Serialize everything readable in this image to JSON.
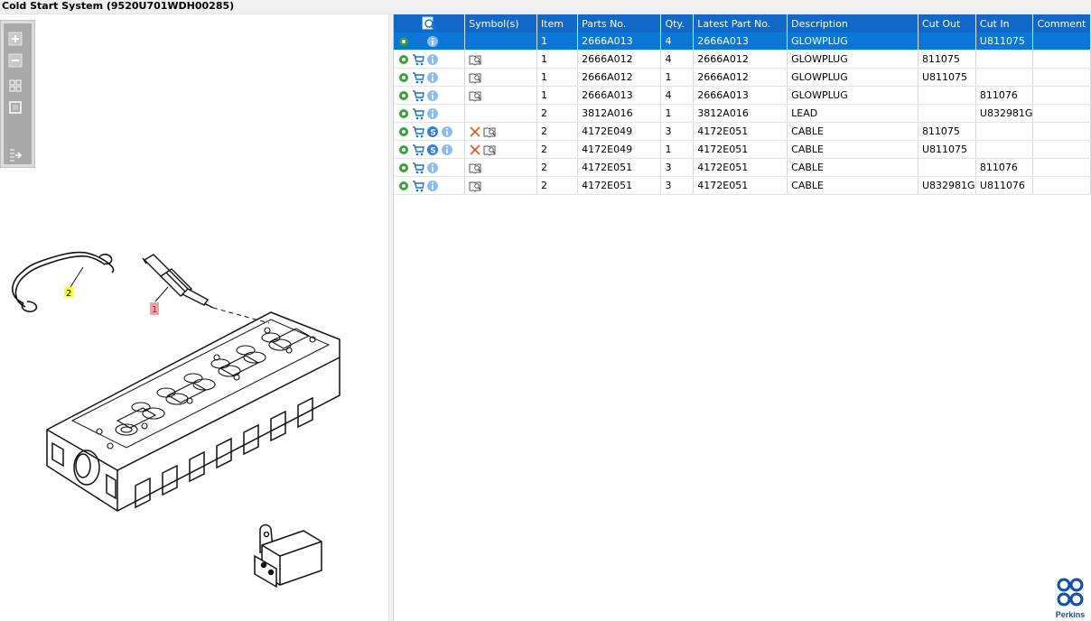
{
  "window": {
    "title": "Cold Start System (9520U701WDH00285)"
  },
  "toolbox": {
    "tools": [
      {
        "icon": "zoom-in-icon"
      },
      {
        "icon": "zoom-out-icon"
      },
      {
        "icon": "fit-all-icon"
      },
      {
        "icon": "actual-size-icon"
      },
      {
        "icon": "export-icon"
      }
    ]
  },
  "diagram": {
    "callouts": [
      {
        "label": "1",
        "color": "#f0a0a8"
      },
      {
        "label": "2",
        "color": "#ffff33"
      }
    ]
  },
  "table": {
    "header_icon": "search-parts-icon",
    "columns": [
      "Symbol(s)",
      "Item",
      "Parts No.",
      "Qty.",
      "Latest Part No.",
      "Description",
      "Cut Out",
      "Cut In",
      "Comment"
    ],
    "rows": [
      {
        "s": false,
        "x": false,
        "book": false,
        "item": "1",
        "part": "2666A013",
        "qty": "4",
        "latest": "2666A013",
        "desc": "GLOWPLUG",
        "cutout": "",
        "cutin": "U811075",
        "comment": "",
        "selected": true
      },
      {
        "s": false,
        "x": false,
        "book": true,
        "item": "1",
        "part": "2666A012",
        "qty": "4",
        "latest": "2666A012",
        "desc": "GLOWPLUG",
        "cutout": "811075",
        "cutin": "",
        "comment": "",
        "selected": false
      },
      {
        "s": false,
        "x": false,
        "book": true,
        "item": "1",
        "part": "2666A012",
        "qty": "1",
        "latest": "2666A012",
        "desc": "GLOWPLUG",
        "cutout": "U811075",
        "cutin": "",
        "comment": "",
        "selected": false
      },
      {
        "s": false,
        "x": false,
        "book": true,
        "item": "1",
        "part": "2666A013",
        "qty": "4",
        "latest": "2666A013",
        "desc": "GLOWPLUG",
        "cutout": "",
        "cutin": "811076",
        "comment": "",
        "selected": false
      },
      {
        "s": false,
        "x": false,
        "book": false,
        "item": "2",
        "part": "3812A016",
        "qty": "1",
        "latest": "3812A016",
        "desc": "LEAD",
        "cutout": "",
        "cutin": "U832981G",
        "comment": "",
        "selected": false
      },
      {
        "s": true,
        "x": true,
        "book": true,
        "item": "2",
        "part": "4172E049",
        "qty": "3",
        "latest": "4172E051",
        "desc": "CABLE",
        "cutout": "811075",
        "cutin": "",
        "comment": "",
        "selected": false
      },
      {
        "s": true,
        "x": true,
        "book": true,
        "item": "2",
        "part": "4172E049",
        "qty": "1",
        "latest": "4172E051",
        "desc": "CABLE",
        "cutout": "U811075",
        "cutin": "",
        "comment": "",
        "selected": false
      },
      {
        "s": false,
        "x": false,
        "book": true,
        "item": "2",
        "part": "4172E051",
        "qty": "3",
        "latest": "4172E051",
        "desc": "CABLE",
        "cutout": "",
        "cutin": "811076",
        "comment": "",
        "selected": false
      },
      {
        "s": false,
        "x": false,
        "book": true,
        "item": "2",
        "part": "4172E051",
        "qty": "3",
        "latest": "4172E051",
        "desc": "CABLE",
        "cutout": "U832981G",
        "cutin": "U811076",
        "comment": "",
        "selected": false
      }
    ]
  },
  "brand": {
    "name": "Perkins",
    "color": "#0b4fa8"
  },
  "colors": {
    "header": "#1168c8",
    "selected_row": "#0b78d7",
    "gear": "#3aa13a",
    "cart": "#1c6fd0",
    "info": "#2f7fe0",
    "remove": "#e05a28"
  }
}
